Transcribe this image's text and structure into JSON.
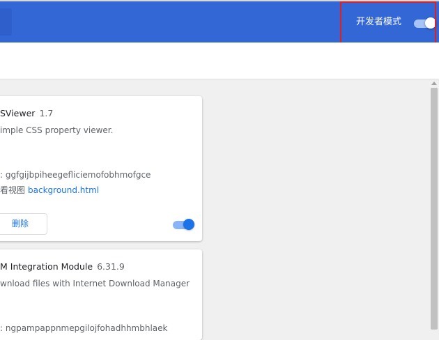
{
  "header": {
    "developer_mode_label": "开发者模式",
    "developer_mode_enabled": true,
    "accent_color": "#3367d6"
  },
  "extensions": [
    {
      "name": "SViewer",
      "version": "1.7",
      "description": "imple CSS property viewer.",
      "id_line": ": ggfgijbpiheegefliciemofobhmofgce",
      "views_label": "看视图",
      "views_link": "background.html",
      "remove_label": "删除",
      "enabled": true
    },
    {
      "name": "M Integration Module",
      "version": "6.31.9",
      "description": "wnload files with Internet Download Manager",
      "id_line": ": ngpampappnmepgilojfohadhhmbhlaek"
    }
  ]
}
